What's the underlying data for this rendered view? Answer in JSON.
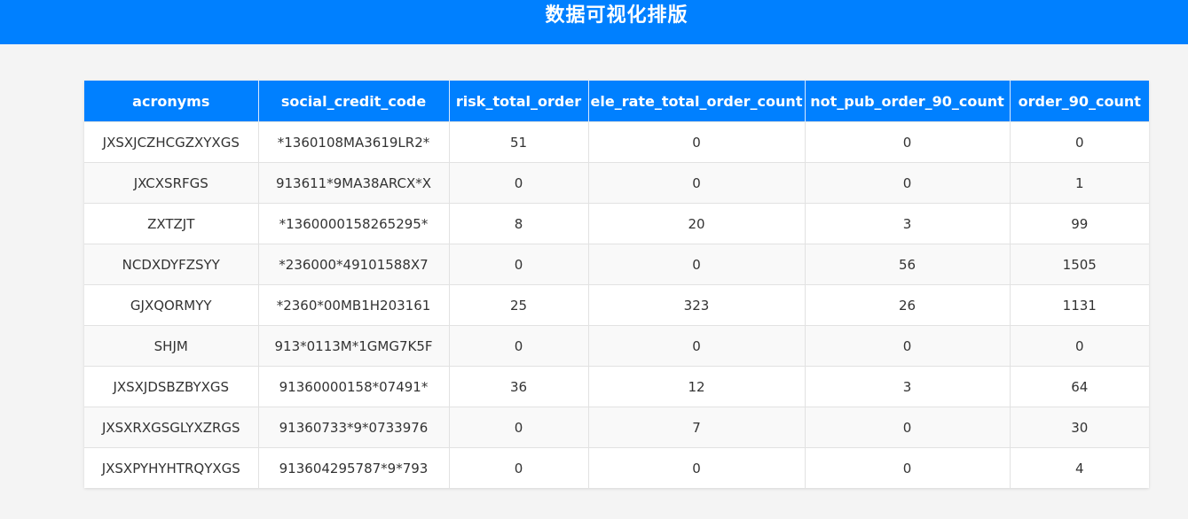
{
  "header": {
    "title": "数据可视化排版",
    "background_color": "#0080ff"
  },
  "table": {
    "columns": [
      "acronyms",
      "social_credit_code",
      "risk_total_order",
      "ele_rate_total_order_count",
      "not_pub_order_90_count",
      "order_90_count"
    ],
    "rows": [
      [
        "JXSXJCZHCGZXYXGS",
        "*1360108MA3619LR2*",
        "51",
        "0",
        "0",
        "0"
      ],
      [
        "JXCXSRFGS",
        "913611*9MA38ARCX*X",
        "0",
        "0",
        "0",
        "1"
      ],
      [
        "ZXTZJT",
        "*1360000158265295*",
        "8",
        "20",
        "3",
        "99"
      ],
      [
        "NCDXDYFZSYY",
        "*236000*49101588X7",
        "0",
        "0",
        "56",
        "1505"
      ],
      [
        "GJXQORMYY",
        "*2360*00MB1H203161",
        "25",
        "323",
        "26",
        "1131"
      ],
      [
        "SHJM",
        "913*0113M*1GMG7K5F",
        "0",
        "0",
        "0",
        "0"
      ],
      [
        "JXSXJDSBZBYXGS",
        "91360000158*07491*",
        "36",
        "12",
        "3",
        "64"
      ],
      [
        "JXSXRXGSGLYXZRGS",
        "91360733*9*0733976",
        "0",
        "7",
        "0",
        "30"
      ],
      [
        "JXSXPYHYHTRQYXGS",
        "913604295787*9*793",
        "0",
        "0",
        "0",
        "4"
      ]
    ]
  }
}
